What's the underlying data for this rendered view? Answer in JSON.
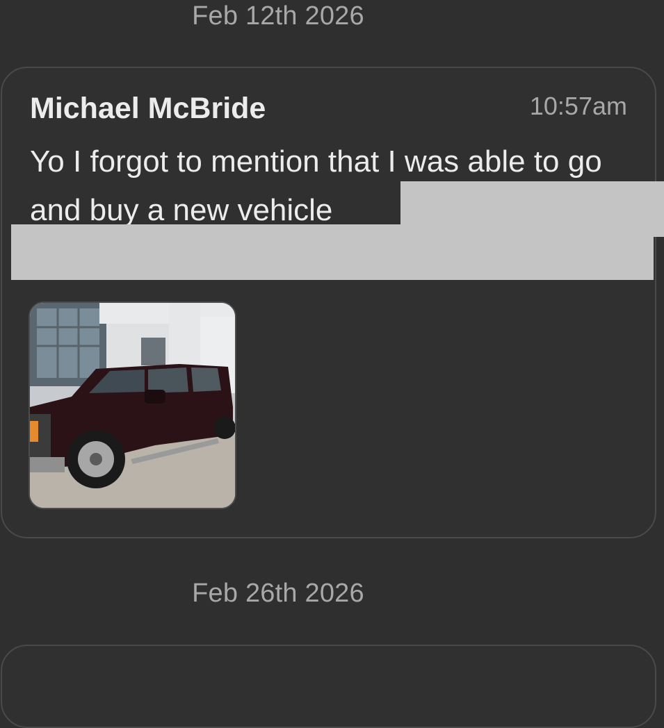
{
  "conversation": {
    "date_separators": [
      "Feb 12th 2026",
      "Feb 26th 2026"
    ],
    "messages": [
      {
        "sender": "Michael McBride",
        "time": "10:57am",
        "text": "Yo I forgot to mention that I was able to go and buy a new vehicle",
        "attachment_icon": "photo-of-pickup-truck",
        "redacted": true
      }
    ]
  },
  "colors": {
    "background": "#2f2f2f",
    "card_border": "#4a4a4a",
    "redaction": "#c4c4c4",
    "muted_text": "#a8a8a8",
    "primary_text": "#ececec"
  }
}
